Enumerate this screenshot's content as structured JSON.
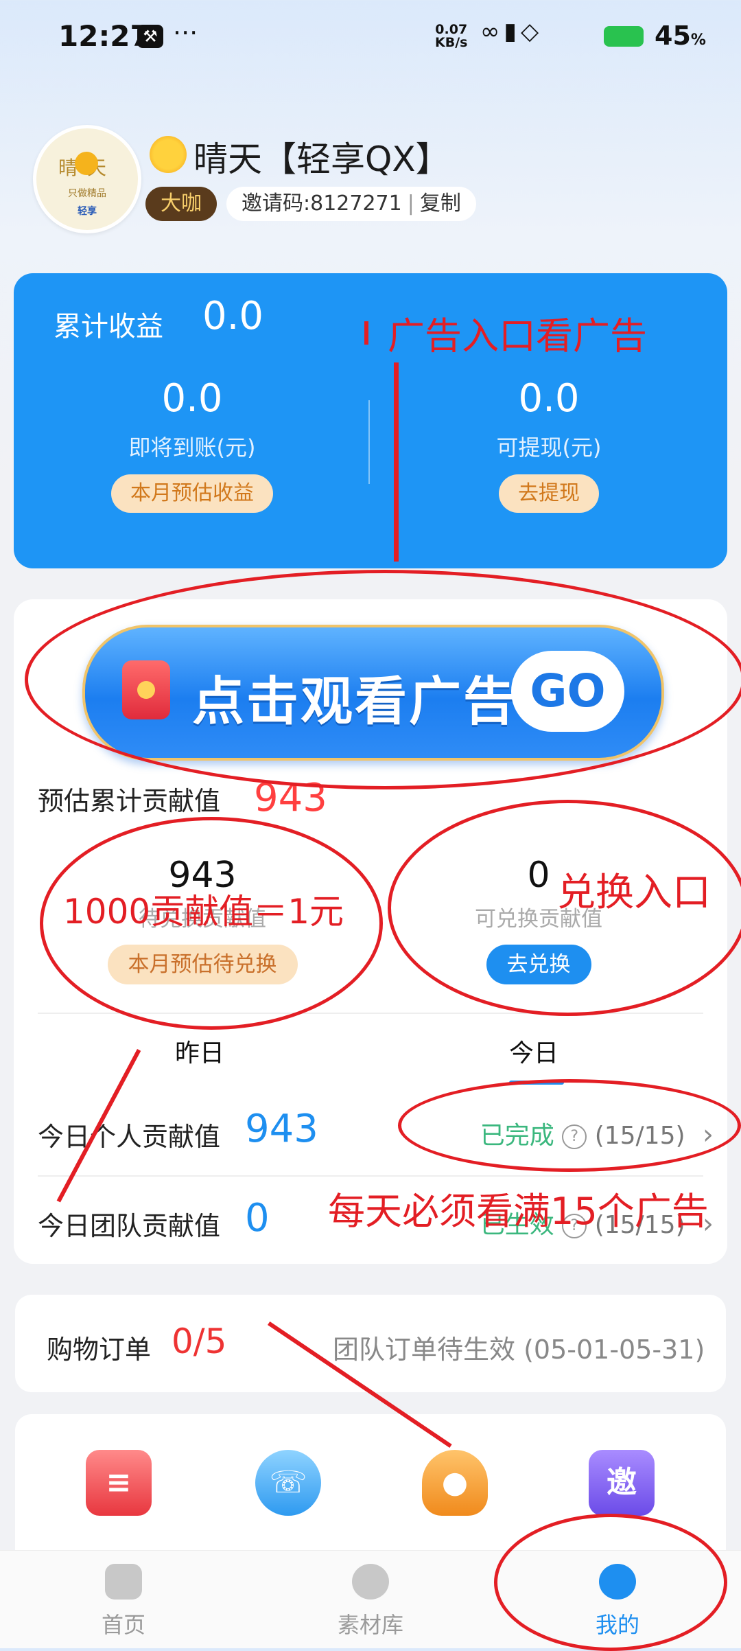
{
  "status": {
    "time": "12:27",
    "speed_top": "0.07",
    "speed_bottom": "KB/s",
    "battery": "45",
    "battery_unit": "%",
    "tool_icon": "wrench-icon",
    "more": "···"
  },
  "profile": {
    "avatar_text": "晴天",
    "avatar_sub": "只做精品",
    "avatar_brand": "轻享",
    "name": "晴天【轻享QX】",
    "level": "大咖",
    "invite_code": "邀请码:8127271",
    "copy": "复制"
  },
  "earnings": {
    "total_label": "累计收益",
    "total_value": "0.0",
    "pending_value": "0.0",
    "pending_label": "即将到账(元)",
    "pending_button": "本月预估收益",
    "withdraw_value": "0.0",
    "withdraw_label": "可提现(元)",
    "withdraw_button": "去提现"
  },
  "ad": {
    "text": "点击观看广告",
    "go": "GO"
  },
  "contribution": {
    "est_label": "预估累计贡献值",
    "est_value": "943",
    "pending_value": "943",
    "pending_label": "待兑换贡献值",
    "pending_button": "本月预估待兑换",
    "exchange_value": "0",
    "exchange_label": "可兑换贡献值",
    "exchange_button": "去兑换",
    "yesterday": "昨日",
    "today": "今日",
    "personal_label": "今日个人贡献值",
    "personal_value": "943",
    "personal_status": "已完成",
    "personal_count": "(15/15)",
    "team_label": "今日团队贡献值",
    "team_value": "0",
    "team_status": "已生效",
    "team_count": "(15/15)"
  },
  "shopping": {
    "label": "购物订单",
    "count": "0/5",
    "status": "团队订单待生效 (05-01-05-31)"
  },
  "functions": [
    {
      "icon": "order-icon",
      "text": ""
    },
    {
      "icon": "customer-service-icon",
      "text": ""
    },
    {
      "icon": "team-icon",
      "text": ""
    },
    {
      "icon": "invite-icon",
      "text": "邀"
    }
  ],
  "tabs": [
    {
      "label": "首页",
      "icon": "home-icon"
    },
    {
      "label": "素材库",
      "icon": "material-icon"
    },
    {
      "label": "我的",
      "icon": "profile-icon"
    }
  ],
  "annotations": {
    "ad_entry": "广告入口看广告",
    "rate": "1000贡献值＝1元",
    "exchange_entry": "兑换入口",
    "daily_rule": "每天必须看满15个广告"
  },
  "colors": {
    "primary": "#1e95f5",
    "accent_red": "#e31e24",
    "peach": "#fbe2c0",
    "success": "#3bb77e"
  }
}
